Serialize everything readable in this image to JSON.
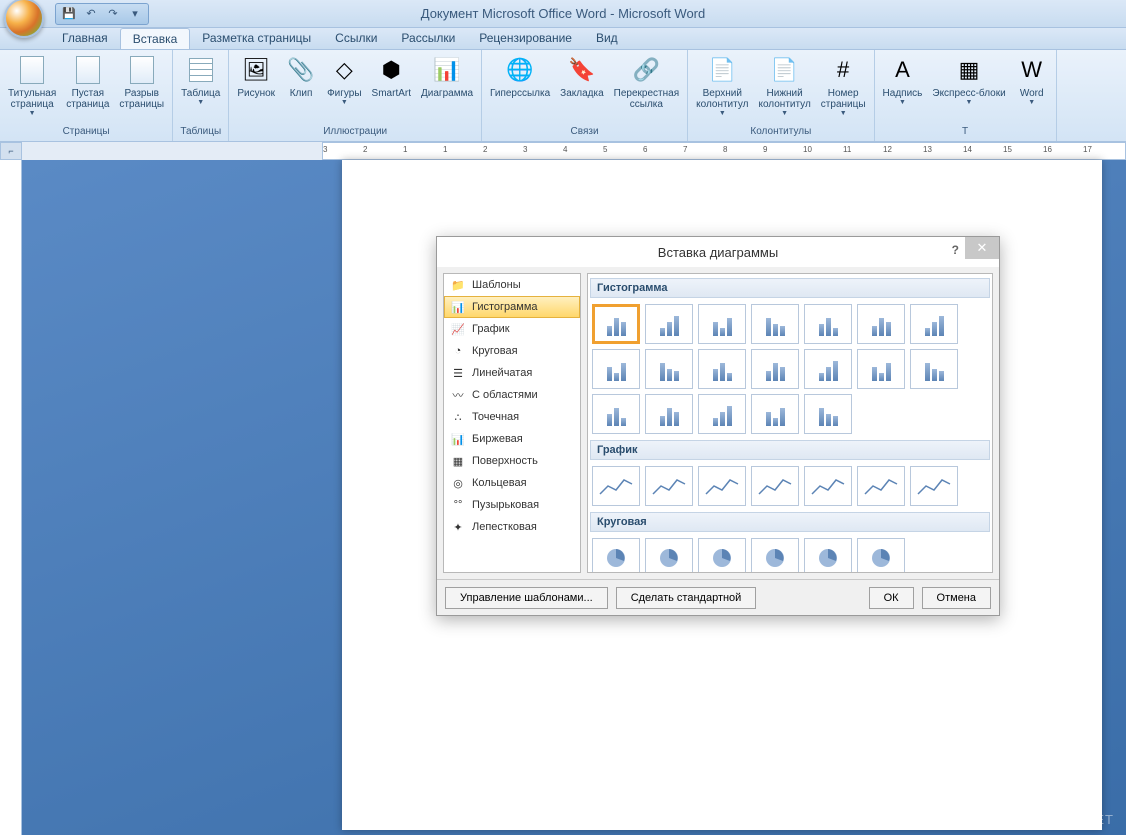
{
  "titlebar": {
    "title": "Документ Microsoft Office Word - Microsoft Word"
  },
  "tabs": [
    "Главная",
    "Вставка",
    "Разметка страницы",
    "Ссылки",
    "Рассылки",
    "Рецензирование",
    "Вид"
  ],
  "active_tab_index": 1,
  "ribbon_groups": [
    {
      "label": "Страницы",
      "buttons": [
        {
          "label": "Титульная\nстраница",
          "dd": true
        },
        {
          "label": "Пустая\nстраница"
        },
        {
          "label": "Разрыв\nстраницы"
        }
      ]
    },
    {
      "label": "Таблицы",
      "buttons": [
        {
          "label": "Таблица",
          "dd": true
        }
      ]
    },
    {
      "label": "Иллюстрации",
      "buttons": [
        {
          "label": "Рисунок"
        },
        {
          "label": "Клип"
        },
        {
          "label": "Фигуры",
          "dd": true
        },
        {
          "label": "SmartArt"
        },
        {
          "label": "Диаграмма"
        }
      ]
    },
    {
      "label": "Связи",
      "buttons": [
        {
          "label": "Гиперссылка"
        },
        {
          "label": "Закладка"
        },
        {
          "label": "Перекрестная\nссылка"
        }
      ]
    },
    {
      "label": "Колонтитулы",
      "buttons": [
        {
          "label": "Верхний\nколонтитул",
          "dd": true
        },
        {
          "label": "Нижний\nколонтитул",
          "dd": true
        },
        {
          "label": "Номер\nстраницы",
          "dd": true
        }
      ]
    },
    {
      "label": "Т",
      "buttons": [
        {
          "label": "Надпись",
          "dd": true
        },
        {
          "label": "Экспресс-блоки",
          "dd": true
        },
        {
          "label": "Word",
          "dd": true
        }
      ]
    }
  ],
  "ruler_marks": [
    "3",
    "2",
    "1",
    "1",
    "2",
    "3",
    "4",
    "5",
    "6",
    "7",
    "8",
    "9",
    "10",
    "11",
    "12",
    "13",
    "14",
    "15",
    "16",
    "17"
  ],
  "dialog": {
    "title": "Вставка диаграммы",
    "categories": [
      {
        "icon": "📁",
        "label": "Шаблоны"
      },
      {
        "icon": "📊",
        "label": "Гистограмма",
        "selected": true
      },
      {
        "icon": "📈",
        "label": "График"
      },
      {
        "icon": "◔",
        "label": "Круговая"
      },
      {
        "icon": "☰",
        "label": "Линейчатая"
      },
      {
        "icon": "〰",
        "label": "С областями"
      },
      {
        "icon": "∴",
        "label": "Точечная"
      },
      {
        "icon": "📊",
        "label": "Биржевая"
      },
      {
        "icon": "▦",
        "label": "Поверхность"
      },
      {
        "icon": "◎",
        "label": "Кольцевая"
      },
      {
        "icon": "°°",
        "label": "Пузырьковая"
      },
      {
        "icon": "✦",
        "label": "Лепестковая"
      }
    ],
    "sections": [
      {
        "header": "Гистограмма",
        "count": 19
      },
      {
        "header": "График",
        "count": 7
      },
      {
        "header": "Круговая",
        "count": 6
      }
    ],
    "buttons": {
      "manage_templates": "Управление шаблонами...",
      "set_default": "Сделать стандартной",
      "ok": "ОК",
      "cancel": "Отмена"
    }
  },
  "watermark": "FREE-OFFICE.NET"
}
